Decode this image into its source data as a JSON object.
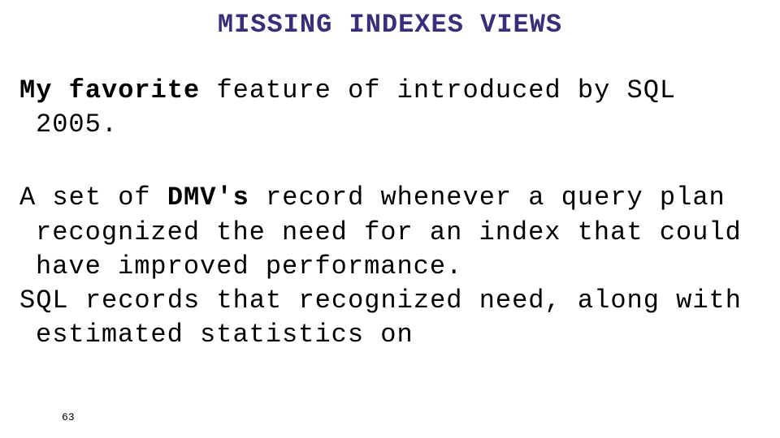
{
  "title": "MISSING INDEXES VIEWS",
  "intro_prefix": "My favorite",
  "intro_rest": " feature of introduced by SQL 2005.",
  "body1_pre": "A set of ",
  "body1_dmv": "DMV's",
  "body1_post": " record whenever a query plan recognized the need for an index that could have improved performance.",
  "body2": "SQL records that recognized need, along with estimated statistics on",
  "page_number": "63"
}
